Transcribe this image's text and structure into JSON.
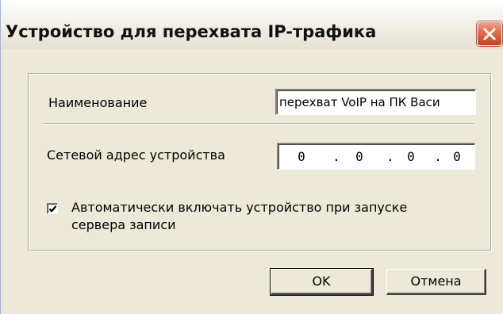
{
  "window": {
    "title": "Устройство для перехвата IP-трафика"
  },
  "form": {
    "name_label": "Наименование",
    "name_value": "перехват VoIP на ПК Васи",
    "address_label": "Сетевой адрес устройства",
    "ip_octets": [
      "0",
      "0",
      "0",
      "0"
    ],
    "autostart_checked": true,
    "autostart_label_line1": "Автоматически включать устройство при запуске",
    "autostart_label_line2": "сервера записи"
  },
  "buttons": {
    "ok_label": "OK",
    "cancel_label": "Отмена"
  },
  "icons": {
    "close": "close-icon",
    "check": "checkmark-icon"
  },
  "colors": {
    "dialog_bg": "#ece9d8",
    "close_button": "#e06b4d"
  }
}
